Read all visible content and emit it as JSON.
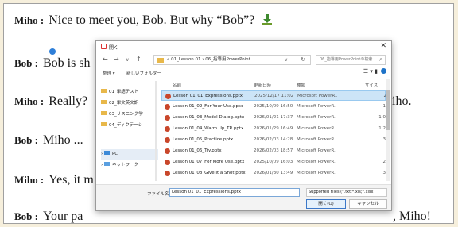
{
  "page": {
    "colors": {
      "background": "#f6efdc",
      "frame": "#ffffff",
      "accent": "#2f7fd8"
    }
  },
  "dialogue": [
    {
      "speaker": "Miho :",
      "text": "Nice to meet you, Bob. But why “Bob”?"
    },
    {
      "speaker": "Bob :",
      "text": "Bob is sh"
    },
    {
      "speaker": "Miho :",
      "text": "Really?"
    },
    {
      "speaker": "Bob :",
      "text": "Miho ..."
    },
    {
      "speaker": "Miho :",
      "text": "Yes, it m"
    },
    {
      "speaker": "Bob :",
      "text": "Your pa"
    }
  ],
  "tails": {
    "line3": "iho.",
    "line6": ", Miho!"
  },
  "dialog": {
    "title": "開く",
    "path": "« 01_Lesson 01 › 06_指導用PowerPoint",
    "search_placeholder": "06_指導用PowerPointの検索",
    "organize": "整理 ▾",
    "new_folder": "新しいフォルダー",
    "nav": [
      "01_単語テスト",
      "02_単文英文訳",
      "03_リスニング学",
      "04_ディクテーシ",
      "PC",
      "ネットワーク"
    ],
    "columns": {
      "name": "名前",
      "date": "更新日時",
      "type": "種類",
      "size": "サイズ"
    },
    "files": [
      {
        "name": "Lesson 01_01_Expressions.pptx",
        "date": "2025/12/17 11:02",
        "type": "Microsoft PowerR..",
        "size": "2"
      },
      {
        "name": "Lesson 01_02_For Your Use.pptx",
        "date": "2025/10/09 16:50",
        "type": "Microsoft PowerR..",
        "size": "1"
      },
      {
        "name": "Lesson 01_03_Model Dialog.pptx",
        "date": "2026/01/21 17:37",
        "type": "Microsoft PowerR..",
        "size": "1,0"
      },
      {
        "name": "Lesson 01_04_Warm Up_TR.pptx",
        "date": "2026/01/29 16:49",
        "type": "Microsoft PowerR..",
        "size": "1,2"
      },
      {
        "name": "Lesson 01_05_Practice.pptx",
        "date": "2026/02/03 14:28",
        "type": "Microsoft PowerR..",
        "size": "3"
      },
      {
        "name": "Lesson 01_06_Try.pptx",
        "date": "2026/02/03 18:57",
        "type": "Microsoft PowerR..",
        "size": ""
      },
      {
        "name": "Lesson 01_07_For More Use.pptx",
        "date": "2025/10/09 16:03",
        "type": "Microsoft PowerR..",
        "size": "2"
      },
      {
        "name": "Lesson 01_08_Give It a Shot.pptx",
        "date": "2026/01/30 13:49",
        "type": "Microsoft PowerR..",
        "size": "3"
      }
    ],
    "filename_label": "ファイル名(N):",
    "filename_value": "Lesson 01_01_Expressions.pptx",
    "filetype": "Supported Files (*.txt;*.xls;*.xlsx",
    "open": "開く(O)",
    "cancel": "キャンセル"
  }
}
